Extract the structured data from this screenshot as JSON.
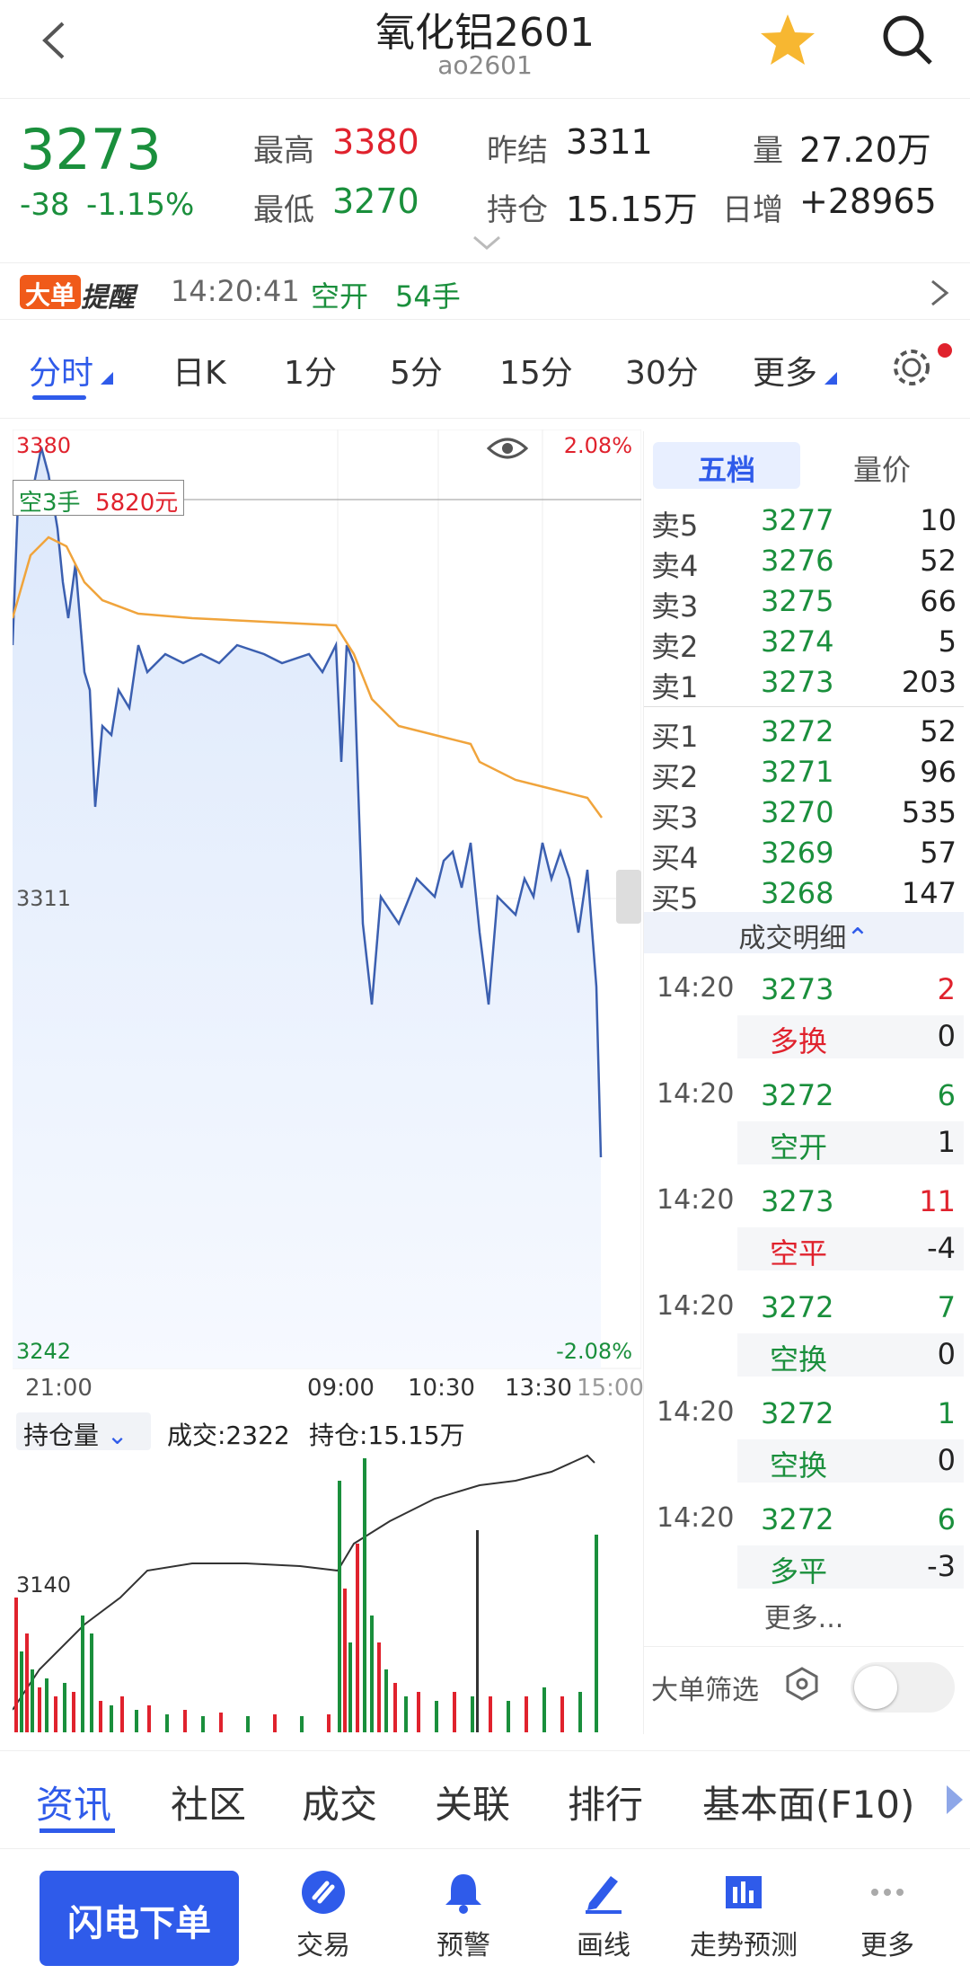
{
  "header": {
    "title": "氧化铝2601",
    "code": "ao2601"
  },
  "quote": {
    "price": "3273",
    "change": "-38",
    "change_pct": "-1.15%",
    "high_label": "最高",
    "high": "3380",
    "low_label": "最低",
    "low": "3270",
    "prev_label": "昨结",
    "prev": "3311",
    "oi_label": "持仓",
    "oi": "15.15万",
    "vol_label": "量",
    "vol": "27.20万",
    "inc_label": "日增",
    "inc": "+28965"
  },
  "alert": {
    "badge1": "大单",
    "badge2": "提醒",
    "time": "14:20:41",
    "type": "空开",
    "size": "54手"
  },
  "tabs": [
    "分时",
    "日K",
    "1分",
    "5分",
    "15分",
    "30分",
    "更多"
  ],
  "chart": {
    "ytop": "3380",
    "ymid": "3311",
    "ybot": "3242",
    "pct_top": "2.08%",
    "pct_bot": "-2.08%",
    "times": [
      "21:00",
      "09:00",
      "10:30",
      "13:30",
      "15:00"
    ],
    "marker": {
      "side": "空3手",
      "amount": "5820元"
    },
    "sub_selector": "持仓量",
    "sub_vol": "成交:2322",
    "sub_oi": "持仓:15.15万",
    "sub_y": "3140"
  },
  "book": {
    "tab_active": "五档",
    "tab_other": "量价",
    "asks": [
      {
        "l": "卖5",
        "p": "3277",
        "v": "10"
      },
      {
        "l": "卖4",
        "p": "3276",
        "v": "52"
      },
      {
        "l": "卖3",
        "p": "3275",
        "v": "66"
      },
      {
        "l": "卖2",
        "p": "3274",
        "v": "5"
      },
      {
        "l": "卖1",
        "p": "3273",
        "v": "203"
      }
    ],
    "bids": [
      {
        "l": "买1",
        "p": "3272",
        "v": "52"
      },
      {
        "l": "买2",
        "p": "3271",
        "v": "96"
      },
      {
        "l": "买3",
        "p": "3270",
        "v": "535"
      },
      {
        "l": "买4",
        "p": "3269",
        "v": "57"
      },
      {
        "l": "买5",
        "p": "3268",
        "v": "147"
      }
    ],
    "detail_title": "成交明细",
    "trades": [
      {
        "t": "14:20",
        "p": "3273",
        "v": "2",
        "vc": "red",
        "type": "多换",
        "tc": "red",
        "oi": "0"
      },
      {
        "t": "14:20",
        "p": "3272",
        "v": "6",
        "vc": "green",
        "type": "空开",
        "tc": "green",
        "oi": "1"
      },
      {
        "t": "14:20",
        "p": "3273",
        "v": "11",
        "vc": "red",
        "type": "空平",
        "tc": "red",
        "oi": "-4"
      },
      {
        "t": "14:20",
        "p": "3272",
        "v": "7",
        "vc": "green",
        "type": "空换",
        "tc": "green",
        "oi": "0"
      },
      {
        "t": "14:20",
        "p": "3272",
        "v": "1",
        "vc": "green",
        "type": "空换",
        "tc": "green",
        "oi": "0"
      },
      {
        "t": "14:20",
        "p": "3272",
        "v": "6",
        "vc": "green",
        "type": "多平",
        "tc": "green",
        "oi": "-3"
      }
    ],
    "more": "更多...",
    "filter": "大单筛选"
  },
  "newstabs": [
    "资讯",
    "社区",
    "成交",
    "关联",
    "排行",
    "基本面(F10)"
  ],
  "bottom": {
    "flash": "闪电下单",
    "items": [
      "交易",
      "预警",
      "画线",
      "走势预测",
      "更多"
    ]
  },
  "colors": {
    "up": "#e0222d",
    "down": "#1a8f3c",
    "accent": "#2f5bea",
    "avg": "#f0a43c",
    "price_line": "#3b5fb0"
  }
}
